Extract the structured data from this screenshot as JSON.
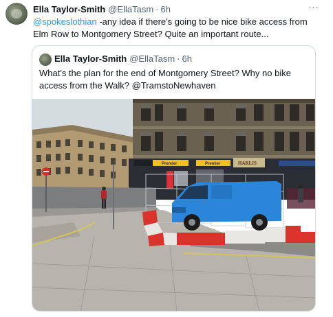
{
  "tweet": {
    "author_name": "Ella Taylor-Smith",
    "author_handle": "@EllaTasm",
    "separator": "·",
    "time": "6h",
    "more_label": "···",
    "mention": "@spokeslothian",
    "text": " -any idea if there's going to be nice bike access from Elm Row to Montgomery Street? Quite an important route..."
  },
  "quoted_tweet": {
    "author_name": "Ella Taylor-Smith",
    "author_handle": "@EllaTasm",
    "separator": "·",
    "time": "6h",
    "text": "What's the plan for the end of Montgomery Street? Why no bike access from the Walk? ",
    "mention": "@TramstoNewhaven"
  },
  "photo": {
    "shop_sign_1": "Premier",
    "shop_sign_2": "Premier",
    "shop_sign_3": "HARLIS",
    "colors": {
      "sky": "#c9d2d9",
      "stone_dark": "#5e5547",
      "stone_light": "#a79a82",
      "van": "#2b85d8",
      "barrier_red": "#d9332c",
      "pavement": "#b7b4ad"
    }
  }
}
